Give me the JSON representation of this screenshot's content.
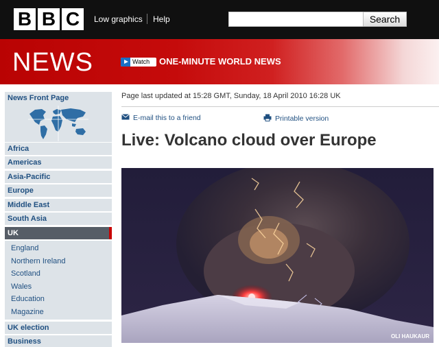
{
  "topbar": {
    "logo_letters": [
      "B",
      "B",
      "C"
    ],
    "links": [
      "Low graphics",
      "Help"
    ],
    "search": {
      "placeholder": "",
      "button_label": "Search"
    }
  },
  "banner": {
    "section": "NEWS",
    "watch_label": "Watch",
    "promo": "ONE-MINUTE WORLD NEWS"
  },
  "sidebar": {
    "items": [
      "News Front Page",
      "Africa",
      "Americas",
      "Asia-Pacific",
      "Europe",
      "Middle East",
      "South Asia",
      "UK"
    ],
    "uk_sub": [
      "England",
      "Northern Ireland",
      "Scotland",
      "Wales",
      "Education",
      "Magazine"
    ],
    "after": [
      "UK election",
      "Business"
    ]
  },
  "article": {
    "updated": "Page last updated at 15:28 GMT, Sunday, 18 April 2010 16:28 UK",
    "email_label": "E-mail this to a friend",
    "print_label": "Printable version",
    "headline": "Live: Volcano cloud over Europe",
    "photo_credit": "OLI HAUKAUR"
  },
  "colors": {
    "topbar": "#101010",
    "banner_red": "#b90303",
    "nav_bg": "#dde3e8",
    "nav_text": "#1f4f80",
    "nav_selected": "#565d66",
    "selected_accent": "#c70000"
  }
}
